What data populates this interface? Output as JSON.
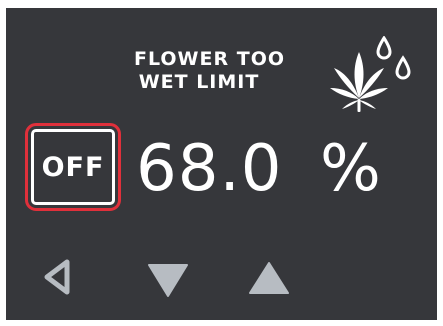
{
  "screen": {
    "title_line1": "FLOWER TOO",
    "title_line2": "WET LIMIT",
    "mode_label": "OFF",
    "value": "68.0",
    "unit": "%",
    "icons": {
      "plant": "cannabis-leaf-with-water-drops-icon",
      "back": "back-triangle-icon",
      "down": "down-triangle-icon",
      "up": "up-triangle-icon"
    },
    "colors": {
      "background": "#36373b",
      "text": "#ffffff",
      "selection_border": "#e0303b",
      "nav_icons": "#b7bcc2"
    }
  }
}
